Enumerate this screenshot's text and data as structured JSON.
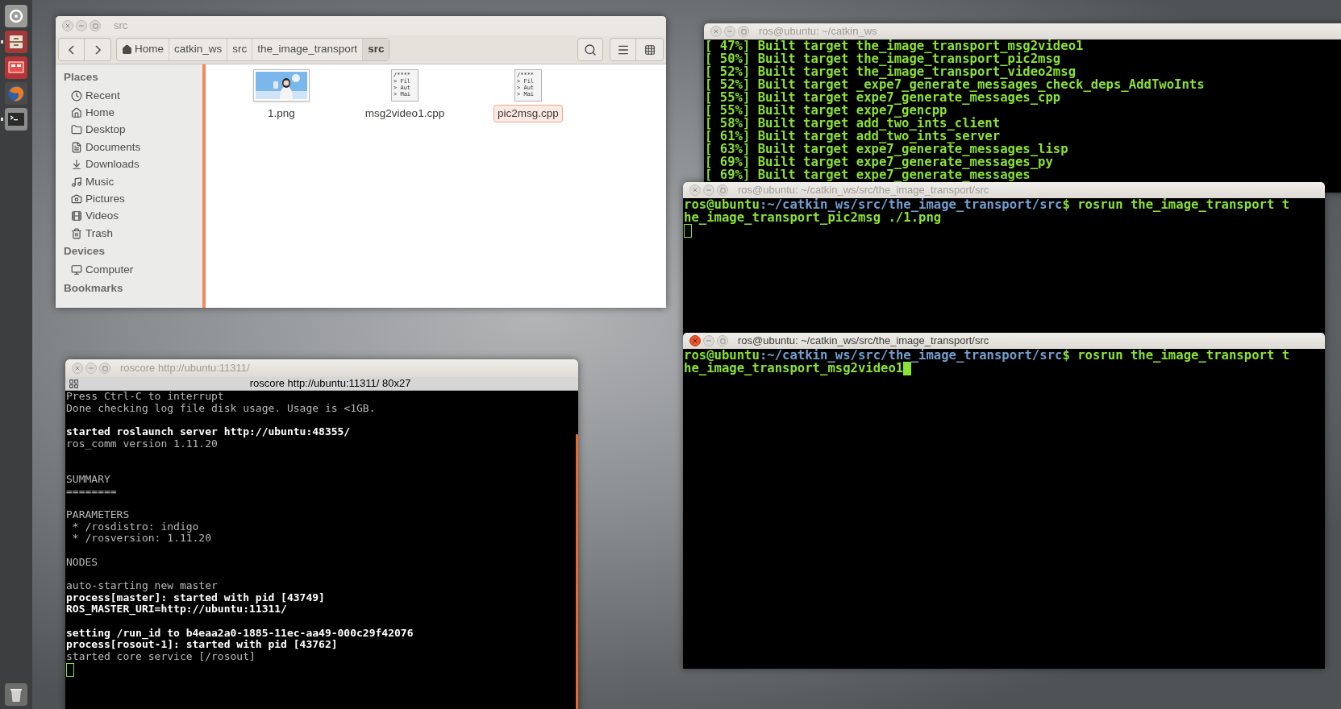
{
  "launcher": [
    {
      "kind": "dash",
      "running": false
    },
    {
      "kind": "files",
      "running": true
    },
    {
      "kind": "slides",
      "running": false
    },
    {
      "kind": "browser",
      "running": false
    },
    {
      "kind": "terminal",
      "running": true
    },
    {
      "kind": "trash",
      "running": false
    }
  ],
  "file_manager": {
    "title": "src",
    "breadcrumbs": [
      {
        "label": "Home",
        "selected": false
      },
      {
        "label": "catkin_ws",
        "selected": false
      },
      {
        "label": "src",
        "selected": false
      },
      {
        "label": "the_image_transport",
        "selected": false
      },
      {
        "label": "src",
        "selected": true
      }
    ],
    "sidebar": [
      {
        "heading": "Places",
        "items": [
          {
            "label": "Recent",
            "kind": "recent"
          },
          {
            "label": "Home",
            "kind": "home"
          },
          {
            "label": "Desktop",
            "kind": "folder"
          },
          {
            "label": "Documents",
            "kind": "document"
          },
          {
            "label": "Downloads",
            "kind": "download"
          },
          {
            "label": "Music",
            "kind": "music"
          },
          {
            "label": "Pictures",
            "kind": "camera"
          },
          {
            "label": "Videos",
            "kind": "film"
          },
          {
            "label": "Trash",
            "kind": "trash"
          }
        ]
      },
      {
        "heading": "Devices",
        "items": [
          {
            "label": "Computer",
            "kind": "computer"
          }
        ]
      },
      {
        "heading": "Bookmarks"
      }
    ],
    "files": [
      {
        "name": "1.png",
        "kind": "picture",
        "selected": false
      },
      {
        "name": "msg2video1.cpp",
        "kind": "text",
        "preview": [
          "/****",
          "> Fil",
          "> Aut",
          "> Mai"
        ],
        "selected": false
      },
      {
        "name": "pic2msg.cpp",
        "kind": "text",
        "preview": [
          "/****",
          "> Fil",
          "> Aut",
          "> Mai"
        ],
        "selected": true
      }
    ]
  },
  "terminals": [
    {
      "title": "ros@ubuntu: ~/catkin_ws",
      "focused": false,
      "lines": [
        {
          "kind": "green",
          "text": "[ 47%] Built target the_image_transport_msg2video1"
        },
        {
          "kind": "green",
          "text": "[ 50%] Built target the_image_transport_pic2msg"
        },
        {
          "kind": "green",
          "text": "[ 52%] Built target the_image_transport_video2msg"
        },
        {
          "kind": "green",
          "text": "[ 52%] Built target _expe7_generate_messages_check_deps_AddTwoInts"
        },
        {
          "kind": "green",
          "text": "[ 55%] Built target expe7_generate_messages_cpp"
        },
        {
          "kind": "green",
          "text": "[ 55%] Built target expe7_gencpp"
        },
        {
          "kind": "green",
          "text": "[ 58%] Built target add_two_ints_client"
        },
        {
          "kind": "green",
          "text": "[ 61%] Built target add_two_ints_server"
        },
        {
          "kind": "green",
          "text": "[ 63%] Built target expe7_generate_messages_lisp"
        },
        {
          "kind": "green",
          "text": "[ 69%] Built target expe7_generate_messages_py"
        },
        {
          "kind": "green",
          "text": "[ 69%] Built target expe7_generate_messages"
        }
      ]
    },
    {
      "title": "ros@ubuntu: ~/catkin_ws/src/the_image_transport/src",
      "focused": false,
      "lines": [
        {
          "kind": "prompt",
          "user": "ros@ubuntu",
          "path": ":~/catkin_ws/src/the_image_transport/src",
          "command": "$ rosrun the_image_transport t"
        },
        {
          "kind": "green",
          "text": "he_image_transport_pic2msg ./1.png"
        },
        {
          "kind": "cursor"
        }
      ]
    },
    {
      "title": "ros@ubuntu: ~/catkin_ws/src/the_image_transport/src",
      "focused": true,
      "lines": [
        {
          "kind": "prompt",
          "user": "ros@ubuntu",
          "path": ":~/catkin_ws/src/the_image_transport/src",
          "command": "$ rosrun the_image_transport t"
        },
        {
          "kind": "green",
          "text": "he_image_transport_msg2video1",
          "cursor_after": true
        }
      ]
    },
    {
      "title": "roscore http://ubuntu:11311/",
      "tab_title": "roscore http://ubuntu:11311/ 80x27",
      "focused": false,
      "lines": [
        {
          "kind": "plain",
          "text": "Press Ctrl-C to interrupt"
        },
        {
          "kind": "plain",
          "text": "Done checking log file disk usage. Usage is <1GB."
        },
        {
          "kind": "blank"
        },
        {
          "kind": "bold",
          "text": "started roslaunch server http://ubuntu:48355/"
        },
        {
          "kind": "plain",
          "text": "ros_comm version 1.11.20"
        },
        {
          "kind": "blank"
        },
        {
          "kind": "blank"
        },
        {
          "kind": "plain",
          "text": "SUMMARY"
        },
        {
          "kind": "plain",
          "text": "========"
        },
        {
          "kind": "blank"
        },
        {
          "kind": "plain",
          "text": "PARAMETERS"
        },
        {
          "kind": "plain",
          "text": " * /rosdistro: indigo"
        },
        {
          "kind": "plain",
          "text": " * /rosversion: 1.11.20"
        },
        {
          "kind": "blank"
        },
        {
          "kind": "plain",
          "text": "NODES"
        },
        {
          "kind": "blank"
        },
        {
          "kind": "plain",
          "text": "auto-starting new master"
        },
        {
          "kind": "bold",
          "text": "process[master]: started with pid [43749]"
        },
        {
          "kind": "bold",
          "text": "ROS_MASTER_URI=http://ubuntu:11311/"
        },
        {
          "kind": "blank"
        },
        {
          "kind": "bold",
          "text": "setting /run_id to b4eaa2a0-1885-11ec-aa49-000c29f42076"
        },
        {
          "kind": "bold",
          "text": "process[rosout-1]: started with pid [43762]"
        },
        {
          "kind": "plain",
          "text": "started core service [/rosout]"
        },
        {
          "kind": "cursor"
        }
      ]
    }
  ]
}
